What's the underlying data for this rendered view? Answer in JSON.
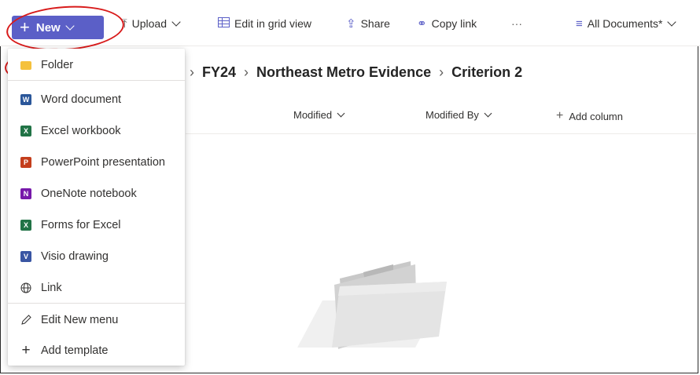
{
  "toolbar": {
    "new_label": "New",
    "upload_label": "Upload",
    "grid_label": "Edit in grid view",
    "share_label": "Share",
    "copy_link_label": "Copy link",
    "more_label": "···",
    "view_label": "All Documents*"
  },
  "breadcrumb": {
    "items": [
      "FY24",
      "Northeast Metro Evidence",
      "Criterion 2"
    ]
  },
  "columns": {
    "modified": "Modified",
    "modified_by": "Modified By",
    "add_column": "Add column"
  },
  "new_menu": {
    "items": [
      {
        "label": "Folder",
        "icon": "folder-icon"
      },
      {
        "label": "Word document",
        "icon": "word-icon"
      },
      {
        "label": "Excel workbook",
        "icon": "excel-icon"
      },
      {
        "label": "PowerPoint presentation",
        "icon": "powerpoint-icon"
      },
      {
        "label": "OneNote notebook",
        "icon": "onenote-icon"
      },
      {
        "label": "Forms for Excel",
        "icon": "forms-icon"
      },
      {
        "label": "Visio drawing",
        "icon": "visio-icon"
      },
      {
        "label": "Link",
        "icon": "globe-icon"
      },
      {
        "label": "Edit New menu",
        "icon": "pencil-icon"
      },
      {
        "label": "Add template",
        "icon": "plus-icon"
      }
    ]
  },
  "colors": {
    "accent": "#5b5fc7",
    "annotation": "#d81b1b"
  }
}
